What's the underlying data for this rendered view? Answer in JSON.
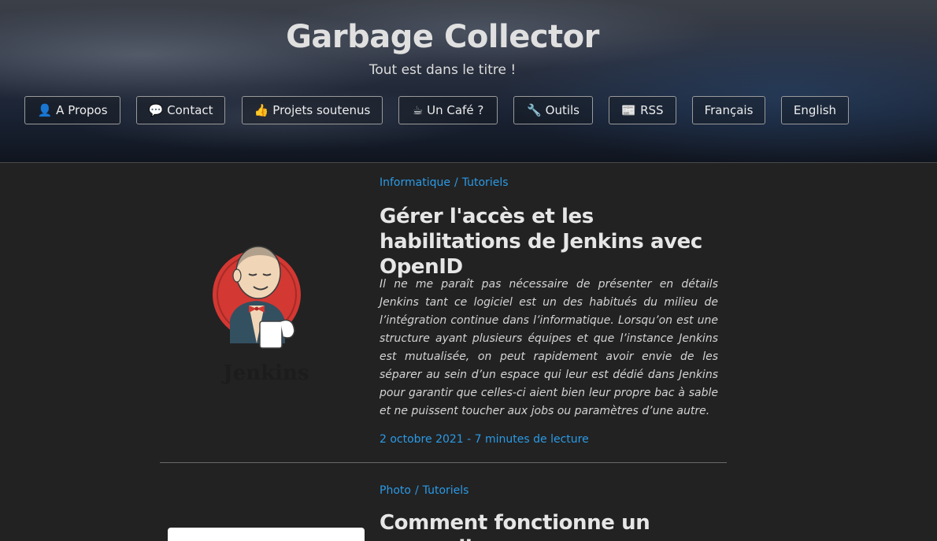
{
  "header": {
    "title": "Garbage Collector",
    "subtitle": "Tout est dans le titre !",
    "nav": [
      {
        "icon": "👤",
        "icon_name": "user-icon",
        "label": "A Propos"
      },
      {
        "icon": "💬",
        "icon_name": "speech-bubble-icon",
        "label": "Contact"
      },
      {
        "icon": "👍",
        "icon_name": "thumbs-up-icon",
        "label": "Projets soutenus"
      },
      {
        "icon": "☕",
        "icon_name": "coffee-icon",
        "label": "Un Café ?"
      },
      {
        "icon": "🔧",
        "icon_name": "wrench-icon",
        "label": "Outils"
      },
      {
        "icon": "📰",
        "icon_name": "newspaper-icon",
        "label": "RSS"
      },
      {
        "icon": "",
        "icon_name": "",
        "label": "Français"
      },
      {
        "icon": "",
        "icon_name": "",
        "label": "English"
      }
    ]
  },
  "posts": [
    {
      "categories": [
        "Informatique",
        "Tutoriels"
      ],
      "title": "Gérer l'accès et les habilitations de Jenkins avec OpenID",
      "excerpt": "Il ne me paraît pas nécessaire de présenter en détails Jenkins tant ce logiciel est un des habitués du milieu de l’intégration continue dans l’informatique. Lorsqu’on est une structure ayant plusieurs équipes et que l’instance Jenkins est mutualisée, on peut rapidement avoir envie de les séparer au sein d’un espace qui leur est dédié dans Jenkins pour garantir que celles-ci aient bien leur propre bac à sable et ne puissent toucher aux jobs ou paramètres d’une autre.",
      "meta": "2 octobre 2021 - 7 minutes de lecture",
      "thumbnail_text": "Jenkins"
    },
    {
      "categories": [
        "Photo",
        "Tutoriels"
      ],
      "title": "Comment fonctionne un appareil"
    }
  ],
  "colors": {
    "accent": "#2b9ae6",
    "background": "#222222",
    "header_bottom": "#10151f"
  }
}
